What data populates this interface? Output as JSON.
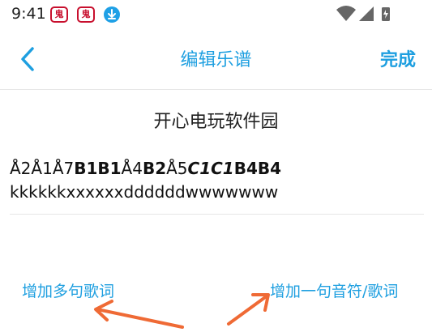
{
  "status_bar": {
    "time": "9:41",
    "app_icon_glyph": "鬼",
    "icons": [
      "app-icon-1",
      "app-icon-2",
      "download-icon",
      "wifi-icon",
      "signal-icon",
      "battery-icon"
    ]
  },
  "toolbar": {
    "title": "编辑乐谱",
    "done_label": "完成",
    "accent_color": "#1e9fe0"
  },
  "score": {
    "title": "开心电玩软件园",
    "notes": [
      {
        "text": "Å2Å1Å7",
        "style": "normal"
      },
      {
        "text": "B1B1",
        "style": "bold"
      },
      {
        "text": "Å4",
        "style": "normal"
      },
      {
        "text": "B2",
        "style": "bold"
      },
      {
        "text": "Å5",
        "style": "normal"
      },
      {
        "text": "C1C1",
        "style": "bold-italic"
      },
      {
        "text": "B4B4",
        "style": "bold"
      }
    ],
    "lyrics": "kkkkkkxxxxxxddddddwwwwwww"
  },
  "actions": {
    "add_multi_lyrics": "增加多句歌词",
    "add_note_lyric": "增加一句音符/歌词"
  },
  "annotation_color": "#ef6a35"
}
